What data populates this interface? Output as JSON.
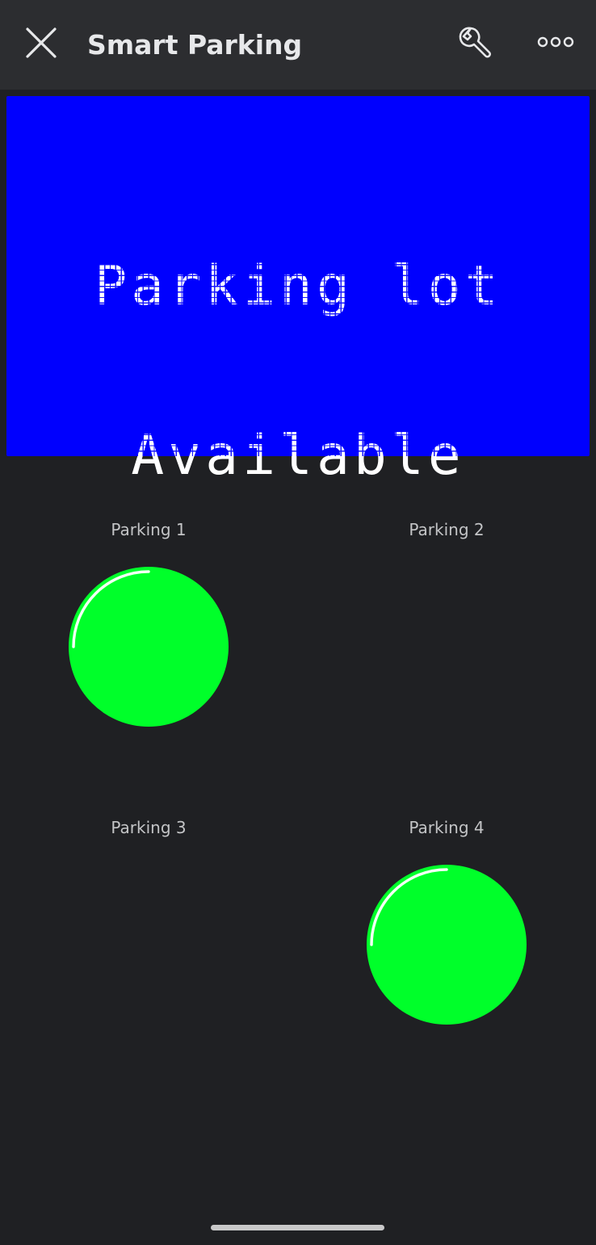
{
  "header": {
    "title": "Smart Parking",
    "close_icon": "close-icon",
    "wrench_icon": "wrench-icon",
    "more_icon": "more-icon"
  },
  "lcd": {
    "line1": "Parking lot",
    "line2": "Available",
    "background_color": "#0000fe",
    "text_color": "#ffffff"
  },
  "slots": [
    {
      "label": "Parking 1",
      "led_on": true
    },
    {
      "label": "Parking 2",
      "led_on": false
    },
    {
      "label": "Parking 3",
      "led_on": false
    },
    {
      "label": "Parking 4",
      "led_on": true
    }
  ],
  "colors": {
    "led_on": "#00ff2a",
    "background": "#1f2023",
    "header_background": "#2c2d30"
  }
}
